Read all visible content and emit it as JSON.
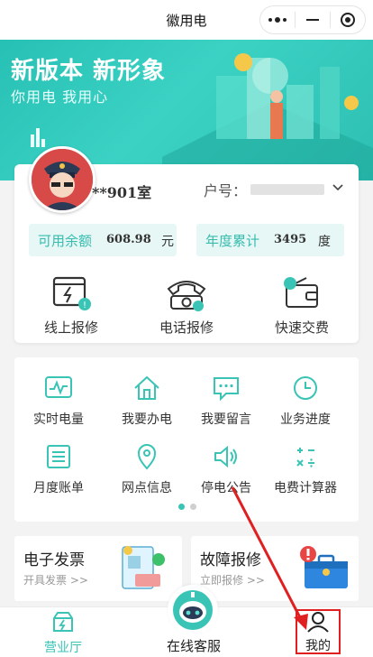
{
  "app": {
    "title": "徽用电"
  },
  "banner": {
    "slogan": "新版本 新形象",
    "subtitle": "你用电 我用心"
  },
  "account": {
    "room": "**901室",
    "account_label": "户号：",
    "balance": {
      "label": "可用余额",
      "value": "608.98",
      "unit": "元"
    },
    "annual": {
      "label": "年度累计",
      "value": "3495",
      "unit": "度"
    }
  },
  "quick_actions": [
    {
      "label": "线上报修",
      "icon": "online-repair-icon"
    },
    {
      "label": "电话报修",
      "icon": "phone-repair-icon"
    },
    {
      "label": "快速交费",
      "icon": "wallet-payment-icon"
    }
  ],
  "services": [
    {
      "label": "实时电量",
      "icon": "realtime-meter-icon"
    },
    {
      "label": "我要办电",
      "icon": "house-icon"
    },
    {
      "label": "我要留言",
      "icon": "message-icon"
    },
    {
      "label": "业务进度",
      "icon": "clock-icon"
    },
    {
      "label": "月度账单",
      "icon": "bill-icon"
    },
    {
      "label": "网点信息",
      "icon": "location-pin-icon"
    },
    {
      "label": "停电公告",
      "icon": "speaker-icon"
    },
    {
      "label": "电费计算器",
      "icon": "calculator-icon"
    }
  ],
  "promos": [
    {
      "title": "电子发票",
      "sub": "开具发票 >>"
    },
    {
      "title": "故障报修",
      "sub": "立即报修 >>"
    }
  ],
  "tabbar": {
    "home": "营业厅",
    "service": "在线客服",
    "me": "我的"
  },
  "colors": {
    "accent": "#39c4b6",
    "highlight": "#e02020"
  }
}
